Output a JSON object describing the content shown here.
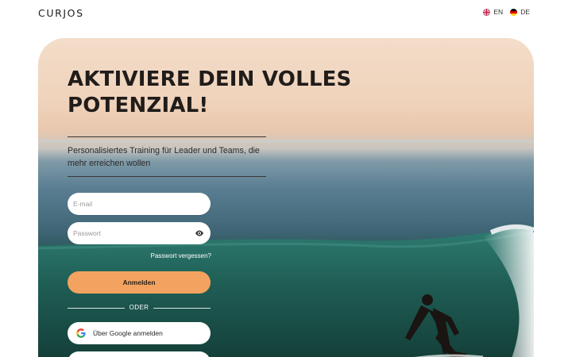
{
  "brand": {
    "logo": "CURJOS"
  },
  "language": {
    "options": [
      {
        "code": "EN",
        "flag_icon": "uk-flag-icon"
      },
      {
        "code": "DE",
        "flag_icon": "germany-flag-icon"
      }
    ]
  },
  "hero": {
    "headline": "AKTIVIERE DEIN VOLLES POTENZIAL!",
    "subtitle": "Personalisiertes Training für Leader und Teams, die mehr erreichen wollen"
  },
  "login": {
    "email_placeholder": "E-mail",
    "password_placeholder": "Passwort",
    "forgot_label": "Passwort vergessen?",
    "submit_label": "Anmelden",
    "divider_label": "ODER",
    "google_label": "Über Google anmelden"
  },
  "colors": {
    "accent": "#f3a35f",
    "hero_top": "#f3ddc9",
    "sea": "#1c4742"
  }
}
